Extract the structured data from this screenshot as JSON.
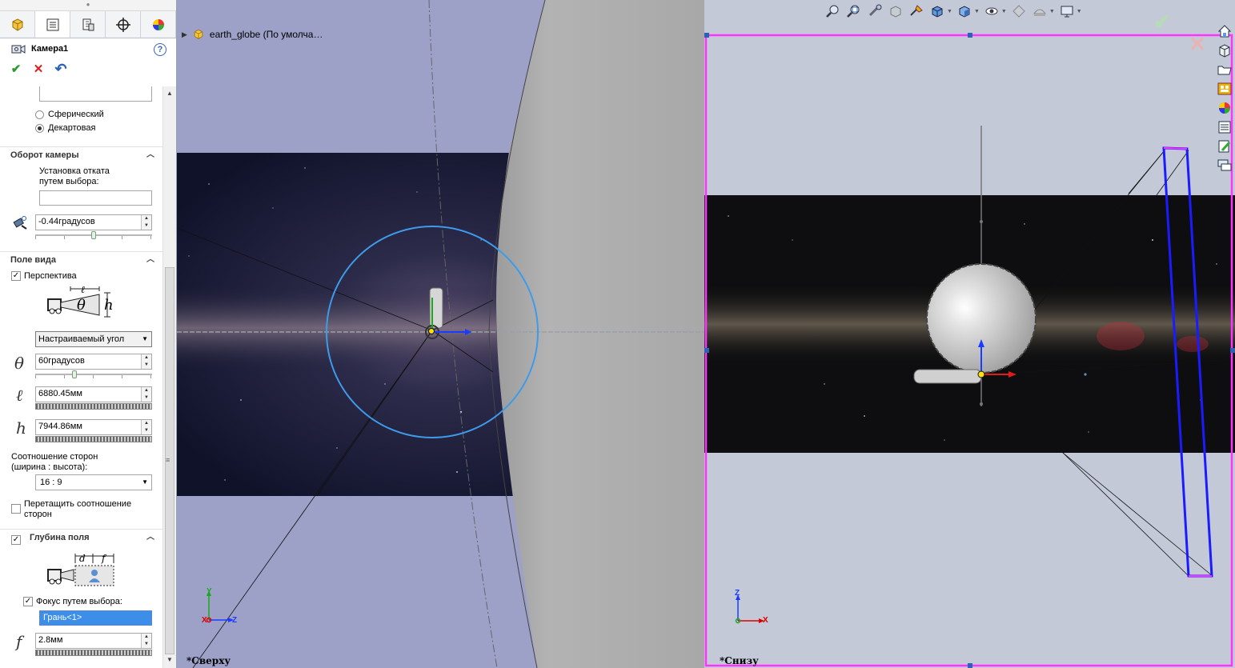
{
  "property_manager": {
    "tabs": [
      "feature-manager",
      "property-manager",
      "configuration-manager",
      "dimxpert-manager",
      "display-manager"
    ],
    "title": "Камера1",
    "help_label": "?",
    "actions": {
      "ok": "✔",
      "cancel": "✕",
      "undo": "↶"
    },
    "target_type": {
      "options": [
        {
          "label": "Сферический",
          "selected": false
        },
        {
          "label": "Декартовая",
          "selected": true
        }
      ]
    },
    "camera_roll": {
      "header": "Оборот камеры",
      "instruction_line1": "Установка отката",
      "instruction_line2": "путем выбора:",
      "selection_value": "",
      "roll_value": "-0.44градусов"
    },
    "field_of_view": {
      "header": "Поле вида",
      "perspective_label": "Перспектива",
      "perspective_checked": true,
      "diagram_labels": {
        "l": "ℓ",
        "theta": "θ",
        "h": "h"
      },
      "mode": "Настраиваемый угол",
      "theta_symbol": "θ",
      "theta_value": "60градусов",
      "l_symbol": "ℓ",
      "l_value": "6880.45мм",
      "h_symbol": "h",
      "h_value": "7944.86мм",
      "aspect_label_line1": "Соотношение сторон",
      "aspect_label_line2": "(ширина : высота):",
      "aspect_value": "16 : 9",
      "drag_aspect_line1": "Перетащить соотношение",
      "drag_aspect_line2": "сторон",
      "drag_aspect_checked": false
    },
    "depth_of_field": {
      "header": "Глубина поля",
      "enabled": true,
      "diagram_labels": {
        "d": "d",
        "f": "f"
      },
      "focus_by_selection_label": "Фокус путем выбора:",
      "focus_by_selection_checked": true,
      "focus_selection": "Грань<1>",
      "f_symbol": "f",
      "f_value": "2.8мм"
    }
  },
  "left_view": {
    "tree_item": "earth_globe  (По умолча…",
    "view_label": "*Сверху",
    "triad": {
      "y": "Y",
      "z": "Z",
      "x": "X"
    }
  },
  "right_view": {
    "view_label": "*Снизу",
    "triad": {
      "z": "Z",
      "x": "X"
    },
    "corner_ok": "✔",
    "corner_cancel": "✕"
  },
  "heads_up_toolbar": [
    "zoom-to-fit-icon",
    "zoom-to-area-icon",
    "previous-view-icon",
    "section-view-icon",
    "dynamic-annotation-icon",
    "view-orientation-icon",
    "display-style-icon",
    "hide-show-items-icon",
    "edit-appearance-icon",
    "apply-scene-icon",
    "view-settings-icon"
  ],
  "task_pane": [
    "home-icon",
    "design-library-icon",
    "file-explorer-icon",
    "view-palette-icon",
    "appearances-icon",
    "custom-properties-icon",
    "forum-icon",
    "comments-icon"
  ],
  "colors": {
    "selection_blue": "#3d8ee8",
    "viewport_left_bg": "#9da1c8",
    "viewport_right_bg": "#c4c9d8",
    "camera_frame": "#ff33ff",
    "focus_plane": "#1b1bff",
    "fov_circle": "#3d9be9"
  }
}
